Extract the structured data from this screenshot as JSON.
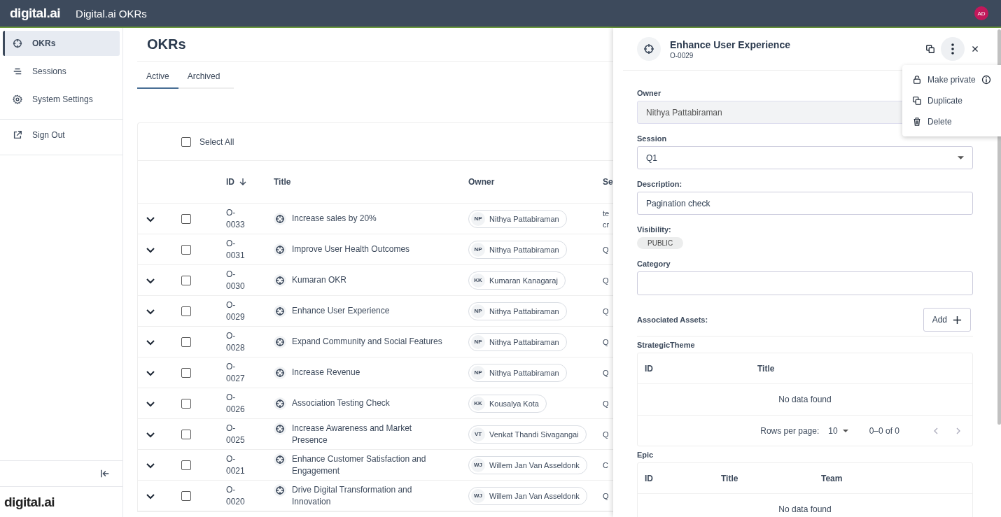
{
  "app": {
    "logo": "digital.ai",
    "title": "Digital.ai OKRs",
    "avatar": "AD"
  },
  "sidebar": {
    "items": [
      {
        "label": "OKRs",
        "selected": true
      },
      {
        "label": "Sessions",
        "selected": false
      },
      {
        "label": "System Settings",
        "selected": false
      }
    ],
    "footer_items": [
      {
        "label": "Sign Out"
      }
    ],
    "footer_logo": "digital.ai"
  },
  "page": {
    "title": "OKRs",
    "tabs": [
      {
        "label": "Active",
        "selected": true
      },
      {
        "label": "Archived",
        "selected": false
      }
    ]
  },
  "table": {
    "select_all": {
      "label": "Select All",
      "checked": false
    },
    "columns": [
      {
        "label": "ID",
        "sorted": true
      },
      {
        "label": "Title"
      },
      {
        "label": "Owner"
      },
      {
        "label": "Se"
      }
    ],
    "rows": [
      {
        "id": "O-0033",
        "title": "Increase sales by 20%",
        "owner_initials": "NP",
        "owner": "Nithya Pattabiraman",
        "column_4": "te cr",
        "checked": false
      },
      {
        "id": "O-0031",
        "title": "Improve User Health Outcomes",
        "owner_initials": "NP",
        "owner": "Nithya Pattabiraman",
        "column_4": "Q",
        "checked": false
      },
      {
        "id": "O-0030",
        "title": "Kumaran OKR",
        "owner_initials": "KK",
        "owner": "Kumaran Kanagaraj",
        "column_4": "Q",
        "checked": false
      },
      {
        "id": "O-0029",
        "title": "Enhance User Experience",
        "owner_initials": "NP",
        "owner": "Nithya Pattabiraman",
        "column_4": "Q",
        "checked": false
      },
      {
        "id": "O-0028",
        "title": "Expand Community and Social Features",
        "owner_initials": "NP",
        "owner": "Nithya Pattabiraman",
        "column_4": "Q",
        "checked": false
      },
      {
        "id": "O-0027",
        "title": "Increase Revenue",
        "owner_initials": "NP",
        "owner": "Nithya Pattabiraman",
        "column_4": "Q",
        "checked": false
      },
      {
        "id": "O-0026",
        "title": "Association Testing Check",
        "owner_initials": "KK",
        "owner": "Kousalya Kota",
        "column_4": "Q",
        "checked": false
      },
      {
        "id": "O-0025",
        "title": "Increase Awareness and Market Presence",
        "owner_initials": "VT",
        "owner": "Venkat Thandi Sivagangai",
        "column_4": "Q",
        "checked": false
      },
      {
        "id": "O-0021",
        "title": "Enhance Customer Satisfaction and Engagement",
        "owner_initials": "WJ",
        "owner": "Willem Jan Van Asseldonk",
        "column_4": "C",
        "checked": false
      },
      {
        "id": "O-0020",
        "title": "Drive Digital Transformation and Innovation",
        "owner_initials": "WJ",
        "owner": "Willem Jan Van Asseldonk",
        "column_4": "Q",
        "checked": false
      }
    ]
  },
  "panel": {
    "title": "Enhance User Experience",
    "id": "O-0029",
    "menu": [
      {
        "label": "Make private",
        "info": true
      },
      {
        "label": "Duplicate",
        "info": false
      },
      {
        "label": "Delete",
        "info": false
      }
    ],
    "owner": {
      "label": "Owner",
      "value": "Nithya Pattabiraman",
      "disabled": true
    },
    "session": {
      "label": "Session",
      "value": "Q1"
    },
    "description": {
      "label": "Description:",
      "value": "Pagination check"
    },
    "visibility": {
      "label": "Visibility:",
      "value": "PUBLIC"
    },
    "category": {
      "label": "Category"
    },
    "associated_assets": {
      "label": "Associated Assets:",
      "add_button": "Add"
    },
    "tables": [
      {
        "title": "StrategicTheme",
        "columns": [
          "ID",
          "Title"
        ],
        "empty": "No data found",
        "pagination": {
          "rows_label": "Rows per page:",
          "rows_value": "10",
          "range": "0–0 of 0"
        }
      },
      {
        "title": "Epic",
        "columns": [
          "ID",
          "Title",
          "Team"
        ],
        "empty": "No data found"
      }
    ]
  }
}
